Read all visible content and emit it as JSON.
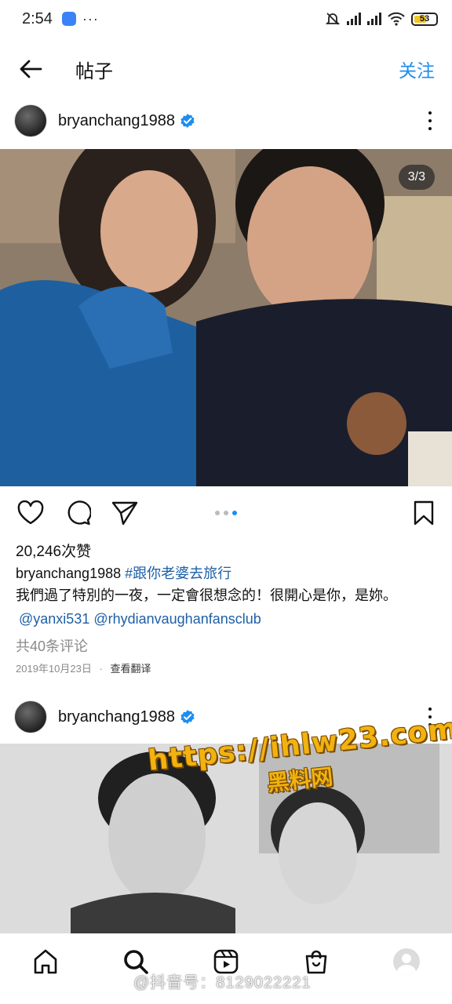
{
  "status_bar": {
    "time": "2:54",
    "more": "···",
    "battery": "53"
  },
  "header": {
    "title": "帖子",
    "follow_label": "关注"
  },
  "posts": [
    {
      "username": "bryanchang1988",
      "image_counter": "3/3",
      "likes": "20,246次赞",
      "caption_user": "bryanchang1988",
      "hashtag": "#跟你老婆去旅行",
      "caption_text": "我們過了特別的一夜，一定會很想念的！很開心是你，是妳。",
      "mentions": [
        "@yanxi531",
        "@rhydianvaughanfansclub"
      ],
      "comments_link": "共40条评论",
      "date": "2019年10月23日",
      "separator": "·",
      "translate_label": "查看翻译"
    },
    {
      "username": "bryanchang1988"
    }
  ],
  "watermark": {
    "line1": "https://ihlw23.com",
    "line2": "黑料网"
  },
  "weibo_watermark": "@抖音号：8129022221",
  "icons": {
    "back": "arrow-left-icon",
    "verified": "verified-badge-icon",
    "more": "more-vertical-icon",
    "like": "heart-icon",
    "comment": "comment-bubble-icon",
    "share": "send-icon",
    "save": "bookmark-icon",
    "home": "home-icon",
    "search": "search-icon",
    "reels": "reels-icon",
    "shop": "shopping-bag-icon",
    "profile": "profile-avatar-icon"
  },
  "colors": {
    "accent": "#1d8ef0",
    "link": "#1d5fa8",
    "muted": "#8a8a8a"
  }
}
